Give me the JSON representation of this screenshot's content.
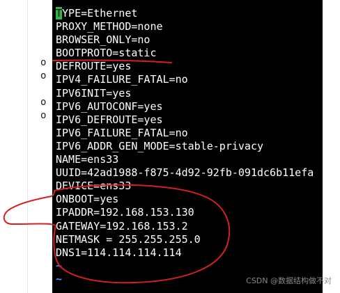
{
  "gutter": {
    "marks": [
      "o",
      "o",
      "o",
      "o"
    ]
  },
  "terminal": {
    "cursor_char": "T",
    "first_line_rest": "YPE=Ethernet",
    "lines": [
      "PROXY_METHOD=none",
      "BROWSER_ONLY=no",
      "BOOTPROTO=static",
      "DEFROUTE=yes",
      "IPV4_FAILURE_FATAL=no",
      "IPV6INIT=yes",
      "IPV6_AUTOCONF=yes",
      "IPV6_DEFROUTE=yes",
      "IPV6_FAILURE_FATAL=no",
      "IPV6_ADDR_GEN_MODE=stable-privacy",
      "NAME=ens33",
      "UUID=42ad1988-f875-4d92-92fb-091dc6b11efa",
      "DEVICE=ens33",
      "ONBOOT=yes",
      "IPADDR=192.168.153.130",
      "GATEWAY=192.168.153.2",
      "NETMASK = 255.255.255.0",
      "DNS1=114.114.114.114"
    ],
    "tilde_1": "~",
    "tilde_2": "~"
  },
  "annotations": {
    "color": "#d42020"
  },
  "watermark": "CSDN @数据结构做不对"
}
